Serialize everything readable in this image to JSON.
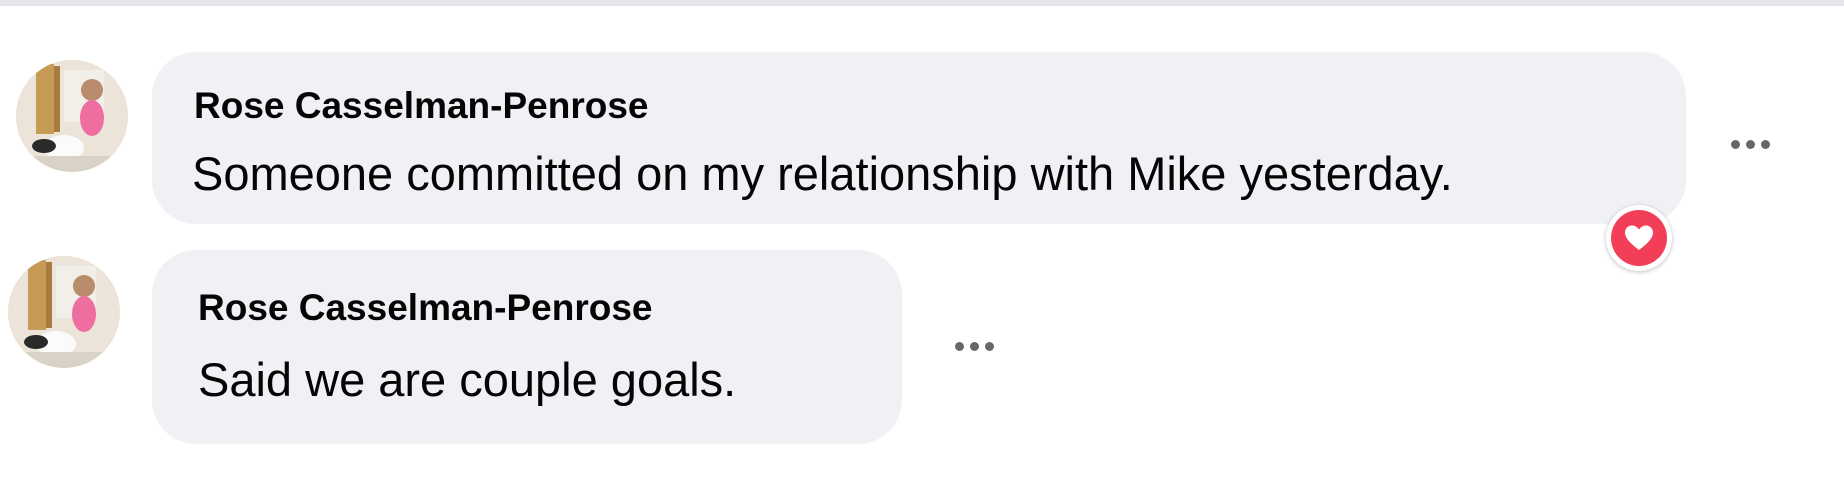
{
  "comments": [
    {
      "author": "Rose Casselman-Penrose",
      "text": "Someone committed on my relationship with Mike yesterday.",
      "reaction_icon": "heart-reaction-icon",
      "more_icon": "more-options-icon"
    },
    {
      "author": "Rose Casselman-Penrose",
      "text": "Said we are couple goals.",
      "more_icon": "more-options-icon"
    }
  ],
  "colors": {
    "bubble": "#eff1f5",
    "text": "#050505",
    "more_dots": "#65676b",
    "heart_reaction": "#f33e58"
  }
}
